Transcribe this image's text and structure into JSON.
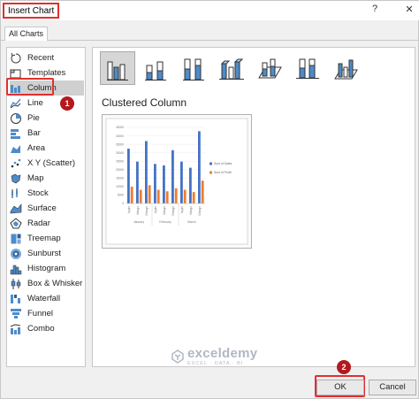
{
  "dialog": {
    "title": "Insert Chart",
    "help_label": "?",
    "close_label": "✕",
    "tab_label": "All Charts"
  },
  "sidebar": {
    "items": [
      {
        "label": "Recent",
        "icon": "recent-icon"
      },
      {
        "label": "Templates",
        "icon": "templates-icon"
      },
      {
        "label": "Column",
        "icon": "column-chart-icon",
        "selected": true
      },
      {
        "label": "Line",
        "icon": "line-chart-icon"
      },
      {
        "label": "Pie",
        "icon": "pie-chart-icon"
      },
      {
        "label": "Bar",
        "icon": "bar-chart-icon"
      },
      {
        "label": "Area",
        "icon": "area-chart-icon"
      },
      {
        "label": "X Y (Scatter)",
        "icon": "scatter-chart-icon"
      },
      {
        "label": "Map",
        "icon": "map-chart-icon"
      },
      {
        "label": "Stock",
        "icon": "stock-chart-icon"
      },
      {
        "label": "Surface",
        "icon": "surface-chart-icon"
      },
      {
        "label": "Radar",
        "icon": "radar-chart-icon"
      },
      {
        "label": "Treemap",
        "icon": "treemap-chart-icon"
      },
      {
        "label": "Sunburst",
        "icon": "sunburst-chart-icon"
      },
      {
        "label": "Histogram",
        "icon": "histogram-chart-icon"
      },
      {
        "label": "Box & Whisker",
        "icon": "box-whisker-chart-icon"
      },
      {
        "label": "Waterfall",
        "icon": "waterfall-chart-icon"
      },
      {
        "label": "Funnel",
        "icon": "funnel-chart-icon"
      },
      {
        "label": "Combo",
        "icon": "combo-chart-icon"
      }
    ]
  },
  "main": {
    "subtype_title": "Clustered Column",
    "selected_subtype_index": 0
  },
  "preview": {
    "y_ticks": [
      "0",
      "5000",
      "10000",
      "15000",
      "20000",
      "25000",
      "30000",
      "35000",
      "40000",
      "45000"
    ],
    "categories": [
      "Apple",
      "Mango",
      "Orange",
      "Apple",
      "Mango",
      "Orange",
      "Apple",
      "Mango",
      "Orange"
    ],
    "groups": [
      "January",
      "February",
      "March"
    ],
    "legend": [
      "Sum of Sales",
      "Sum of Profit"
    ],
    "colors": {
      "sales": "#4472c4",
      "profit": "#ed7d31"
    }
  },
  "annotations": {
    "step1": "1",
    "step2": "2"
  },
  "footer": {
    "ok_label": "OK",
    "cancel_label": "Cancel"
  },
  "watermark": {
    "name": "exceldemy",
    "tagline": "EXCEL · DATA · BI"
  }
}
